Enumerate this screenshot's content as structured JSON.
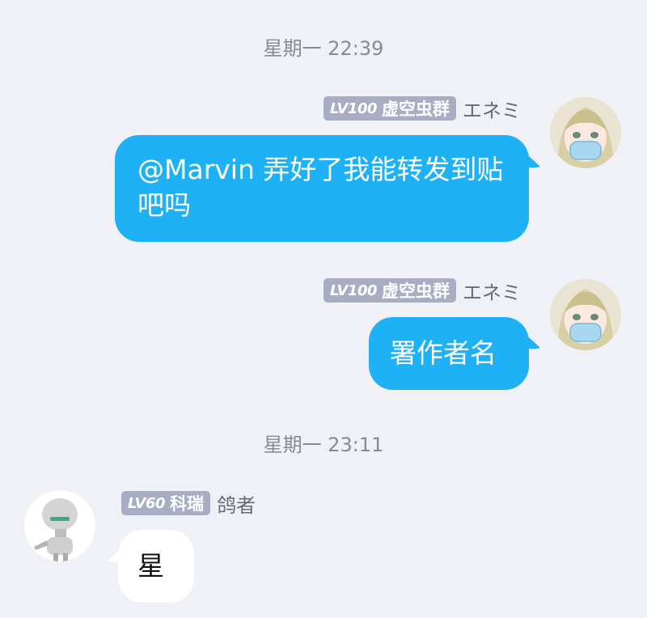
{
  "chat": {
    "timestamps": [
      "星期一 22:39",
      "星期一 23:11"
    ],
    "messages": [
      {
        "level": "LV100",
        "group_title": "虚空虫群",
        "nickname": "エネミ",
        "text": "@Marvin 弄好了我能转发到贴吧吗",
        "direction": "outgoing"
      },
      {
        "level": "LV100",
        "group_title": "虚空虫群",
        "nickname": "エネミ",
        "text": "署作者名",
        "direction": "outgoing"
      },
      {
        "level": "LV60",
        "group_title": "科瑞",
        "nickname": "鸽者",
        "text": "星",
        "direction": "incoming"
      }
    ]
  },
  "colors": {
    "background": "#f0f0f7",
    "outgoing_bubble": "#1fb1f5",
    "incoming_bubble": "#ffffff",
    "badge": "#a9adc4",
    "timestamp": "#8a8a96"
  },
  "icons": {
    "self_avatar": "anime-girl-avatar",
    "other_avatar": "robot-avatar"
  }
}
